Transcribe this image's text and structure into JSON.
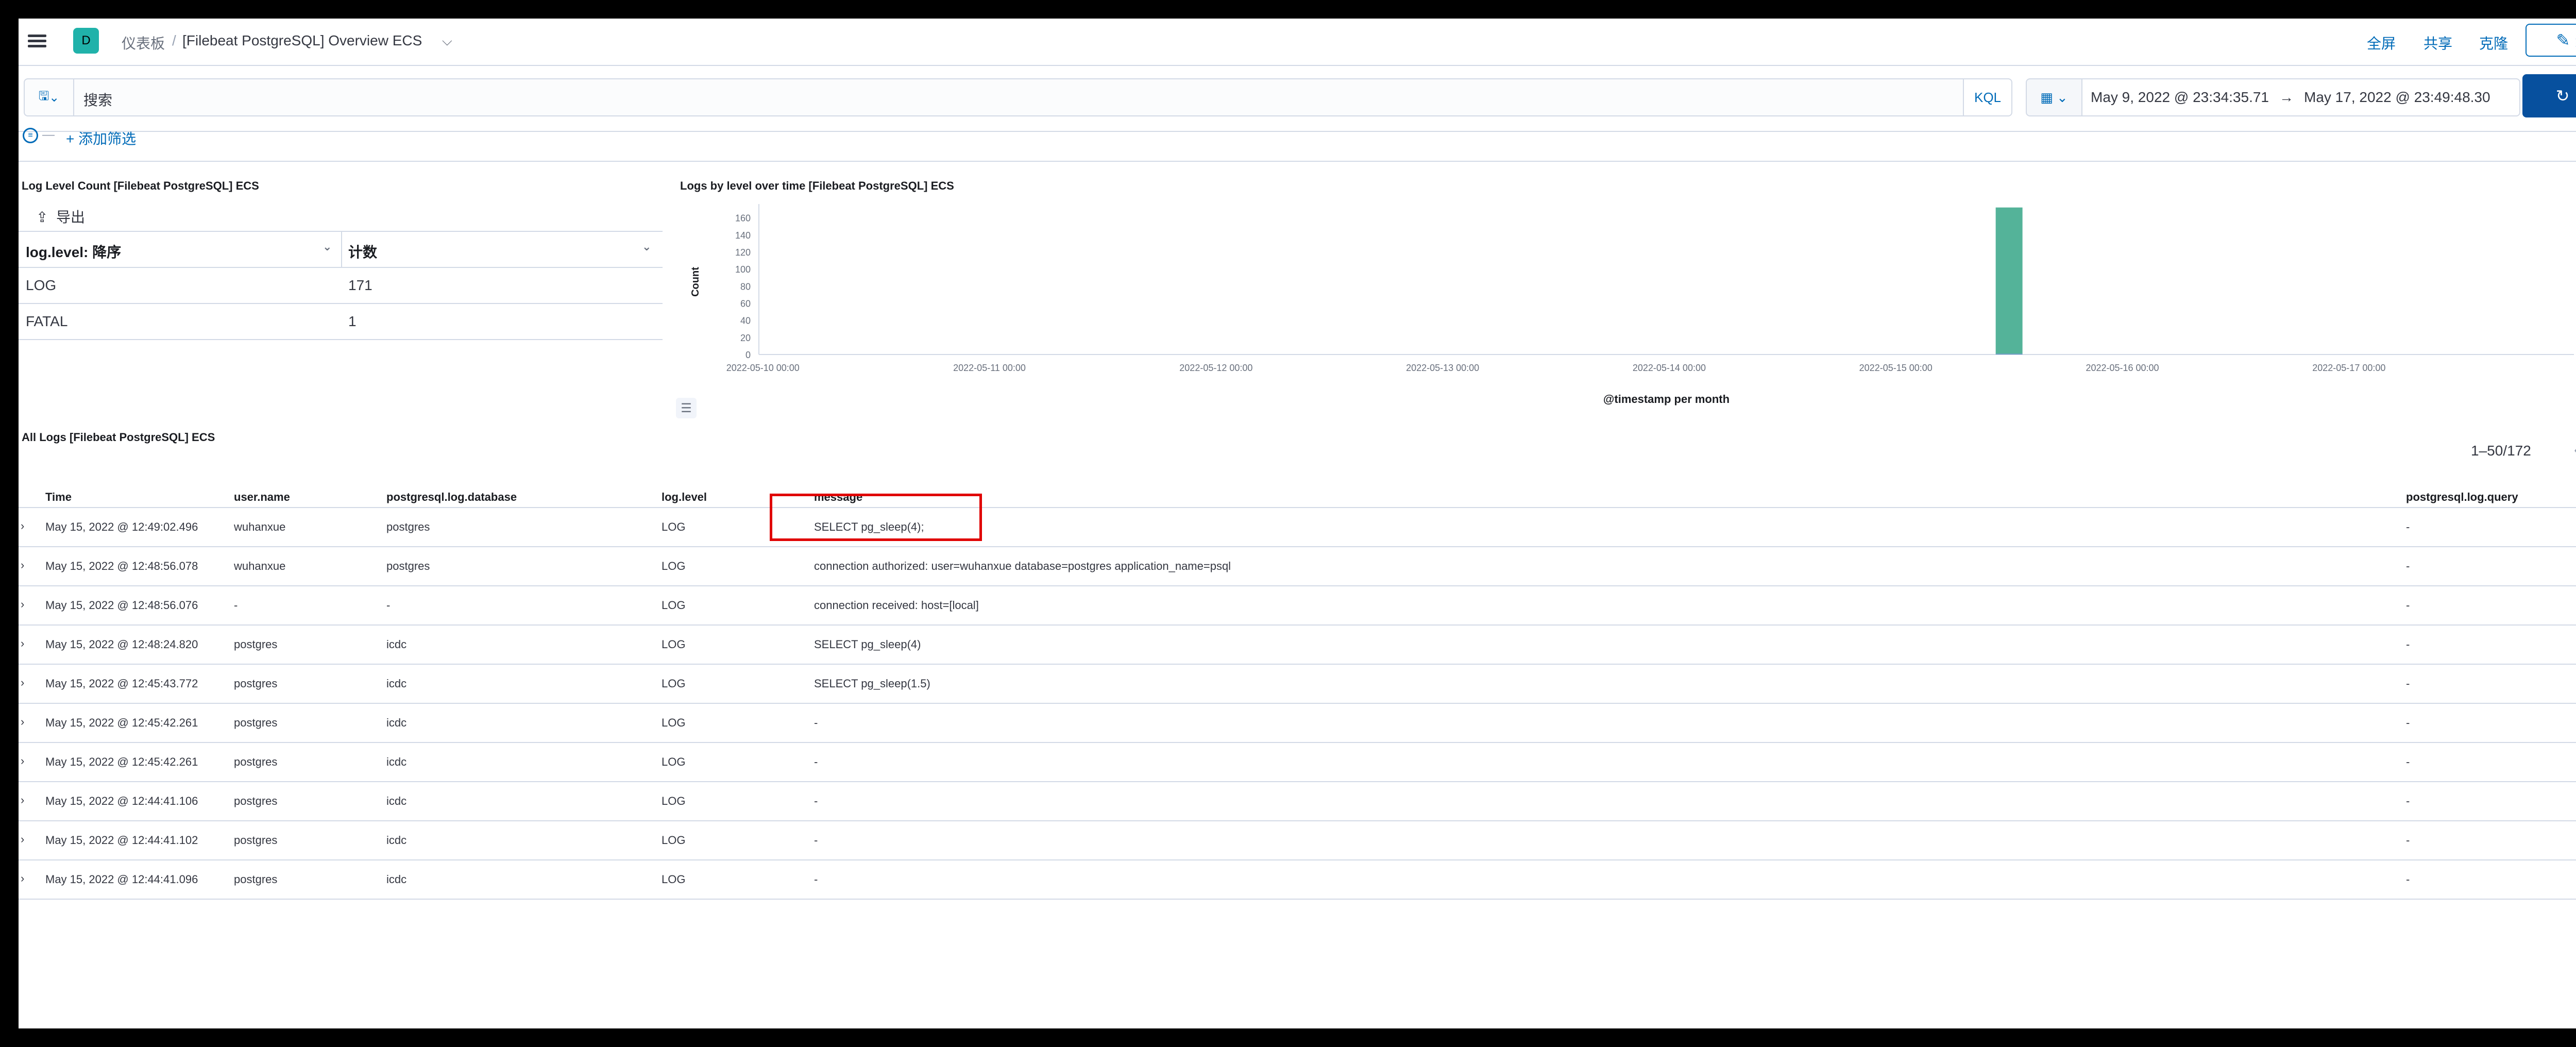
{
  "header": {
    "space_letter": "D",
    "breadcrumb_root": "仪表板",
    "breadcrumb_sep": "/",
    "breadcrumb_current": "[Filebeat PostgreSQL] Overview ECS",
    "fullscreen": "全屏",
    "share": "共享",
    "clone": "克隆",
    "edit": "编辑"
  },
  "query": {
    "search_placeholder": "搜索",
    "language": "KQL",
    "date_start": "May 9, 2022 @ 23:34:35.71",
    "date_arrow": "→",
    "date_end": "May 17, 2022 @ 23:49:48.30",
    "refresh": "刷新",
    "filter_dash": "—",
    "add_filter": "+ 添加筛选"
  },
  "panels": {
    "level_count": {
      "title": "Log Level Count [Filebeat PostgreSQL] ECS",
      "export": "导出",
      "col1": "log.level: 降序",
      "col2": "计数",
      "rows": [
        {
          "level": "LOG",
          "count": "171"
        },
        {
          "level": "FATAL",
          "count": "1"
        }
      ]
    },
    "over_time": {
      "title": "Logs by level over time [Filebeat PostgreSQL] ECS"
    },
    "all_logs": {
      "title": "All Logs [Filebeat PostgreSQL] ECS",
      "pager": "1–50/172",
      "columns": [
        "Time",
        "user.name",
        "postgresql.log.database",
        "log.level",
        "message",
        "postgresql.log.query"
      ],
      "rows": [
        {
          "time": "May 15, 2022 @ 12:49:02.496",
          "user": "wuhanxue",
          "db": "postgres",
          "level": "LOG",
          "message": "SELECT pg_sleep(4);",
          "query": "-"
        },
        {
          "time": "May 15, 2022 @ 12:48:56.078",
          "user": "wuhanxue",
          "db": "postgres",
          "level": "LOG",
          "message": "connection authorized: user=wuhanxue database=postgres application_name=psql",
          "query": "-"
        },
        {
          "time": "May 15, 2022 @ 12:48:56.076",
          "user": "-",
          "db": "-",
          "level": "LOG",
          "message": "connection received: host=[local]",
          "query": "-"
        },
        {
          "time": "May 15, 2022 @ 12:48:24.820",
          "user": "postgres",
          "db": "icdc",
          "level": "LOG",
          "message": "SELECT pg_sleep(4)",
          "query": "-"
        },
        {
          "time": "May 15, 2022 @ 12:45:43.772",
          "user": "postgres",
          "db": "icdc",
          "level": "LOG",
          "message": "SELECT pg_sleep(1.5)",
          "query": "-"
        },
        {
          "time": "May 15, 2022 @ 12:45:42.261",
          "user": "postgres",
          "db": "icdc",
          "level": "LOG",
          "message": "-",
          "query": "-"
        },
        {
          "time": "May 15, 2022 @ 12:45:42.261",
          "user": "postgres",
          "db": "icdc",
          "level": "LOG",
          "message": "-",
          "query": "-"
        },
        {
          "time": "May 15, 2022 @ 12:44:41.106",
          "user": "postgres",
          "db": "icdc",
          "level": "LOG",
          "message": "-",
          "query": "-"
        },
        {
          "time": "May 15, 2022 @ 12:44:41.102",
          "user": "postgres",
          "db": "icdc",
          "level": "LOG",
          "message": "-",
          "query": "-"
        },
        {
          "time": "May 15, 2022 @ 12:44:41.096",
          "user": "postgres",
          "db": "icdc",
          "level": "LOG",
          "message": "-",
          "query": "-"
        }
      ]
    }
  },
  "chart_data": {
    "type": "bar",
    "title": "Logs by level over time [Filebeat PostgreSQL] ECS",
    "xlabel": "@timestamp per month",
    "ylabel": "Count",
    "ylim": [
      0,
      170
    ],
    "yticks": [
      0,
      20,
      40,
      60,
      80,
      100,
      120,
      140,
      160
    ],
    "xticks": [
      "2022-05-10 00:00",
      "2022-05-11 00:00",
      "2022-05-12 00:00",
      "2022-05-13 00:00",
      "2022-05-14 00:00",
      "2022-05-15 00:00",
      "2022-05-16 00:00",
      "2022-05-17 00:00"
    ],
    "xlim": [
      "2022-05-09 23:34:35.71",
      "2022-05-17 23:49:48.30"
    ],
    "series": [
      {
        "name": "FATAL",
        "color": "#6092c0",
        "points": [
          {
            "x": "2022-05-15 12:00",
            "y": 1
          }
        ]
      },
      {
        "name": "LOG",
        "color": "#54b399",
        "points": [
          {
            "x": "2022-05-15 12:00",
            "y": 171
          }
        ]
      }
    ],
    "legend_position": "right",
    "grid": false
  },
  "colors": {
    "accent": "#006bb8",
    "refresh_button": "#07509e",
    "log_bar": "#54b399",
    "fatal_dot": "#6092c0",
    "highlight_box": "#e00000"
  }
}
